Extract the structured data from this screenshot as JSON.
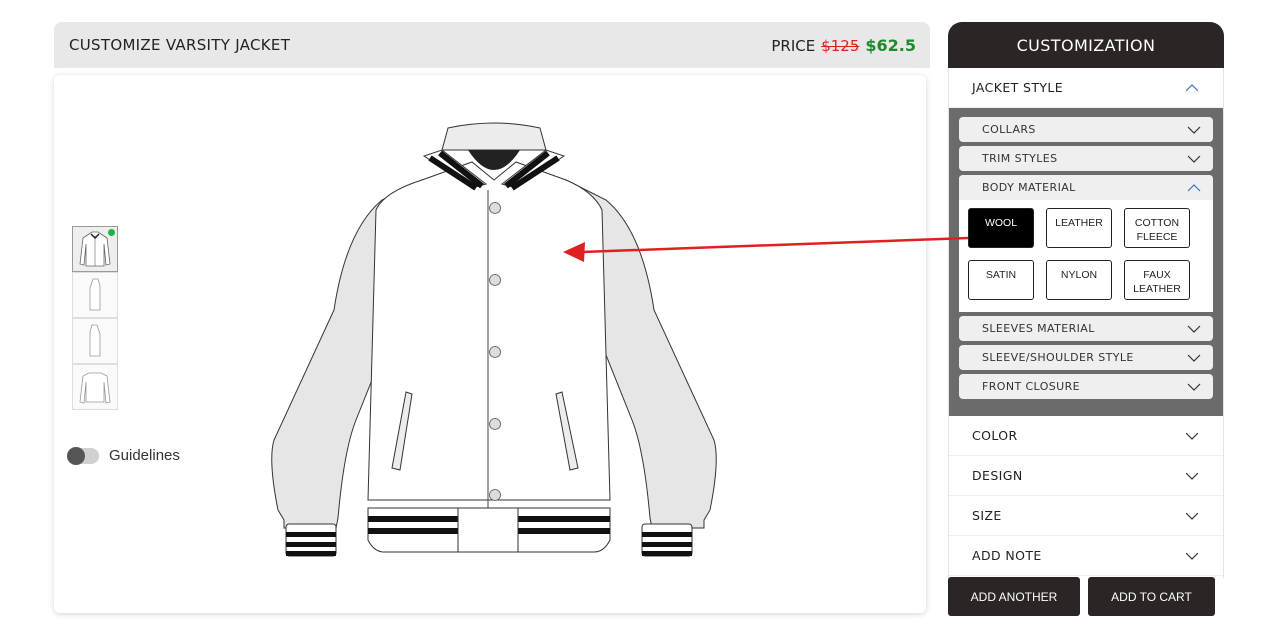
{
  "header": {
    "title": "CUSTOMIZE VARSITY JACKET",
    "price_label": "PRICE",
    "price_old": "$125",
    "price_new": "$62.5"
  },
  "canvas": {
    "guidelines_label": "Guidelines",
    "guidelines_on": false,
    "views": [
      {
        "name": "front",
        "active": true
      },
      {
        "name": "left-side",
        "active": false
      },
      {
        "name": "right-side",
        "active": false
      },
      {
        "name": "back",
        "active": false
      }
    ]
  },
  "panel": {
    "title": "CUSTOMIZATION",
    "jacket_style": "JACKET STYLE",
    "sub": {
      "collars": "COLLARS",
      "trim_styles": "TRIM STYLES",
      "body_material": "BODY MATERIAL",
      "sleeves_material": "SLEEVES MATERIAL",
      "sleeve_shoulder_style": "SLEEVE/SHOULDER STYLE",
      "front_closure": "FRONT CLOSURE"
    },
    "materials": {
      "wool": "WOOL",
      "leather": "LEATHER",
      "cotton_fleece_1": "COTTON",
      "cotton_fleece_2": "FLEECE",
      "satin": "SATIN",
      "nylon": "NYLON",
      "faux_leather_1": "FAUX",
      "faux_leather_2": "LEATHER",
      "selected": "WOOL"
    },
    "color": "COLOR",
    "design": "DESIGN",
    "size": "SIZE",
    "add_note": "ADD NOTE"
  },
  "actions": {
    "add_another": "ADD ANOTHER",
    "add_to_cart": "ADD TO CART"
  },
  "colors": {
    "dark": "#2b2525",
    "price_old": "#e02020",
    "price_new": "#1e8a2c",
    "arrow": "#e02020",
    "submenu_bg": "#6b6b6b"
  }
}
